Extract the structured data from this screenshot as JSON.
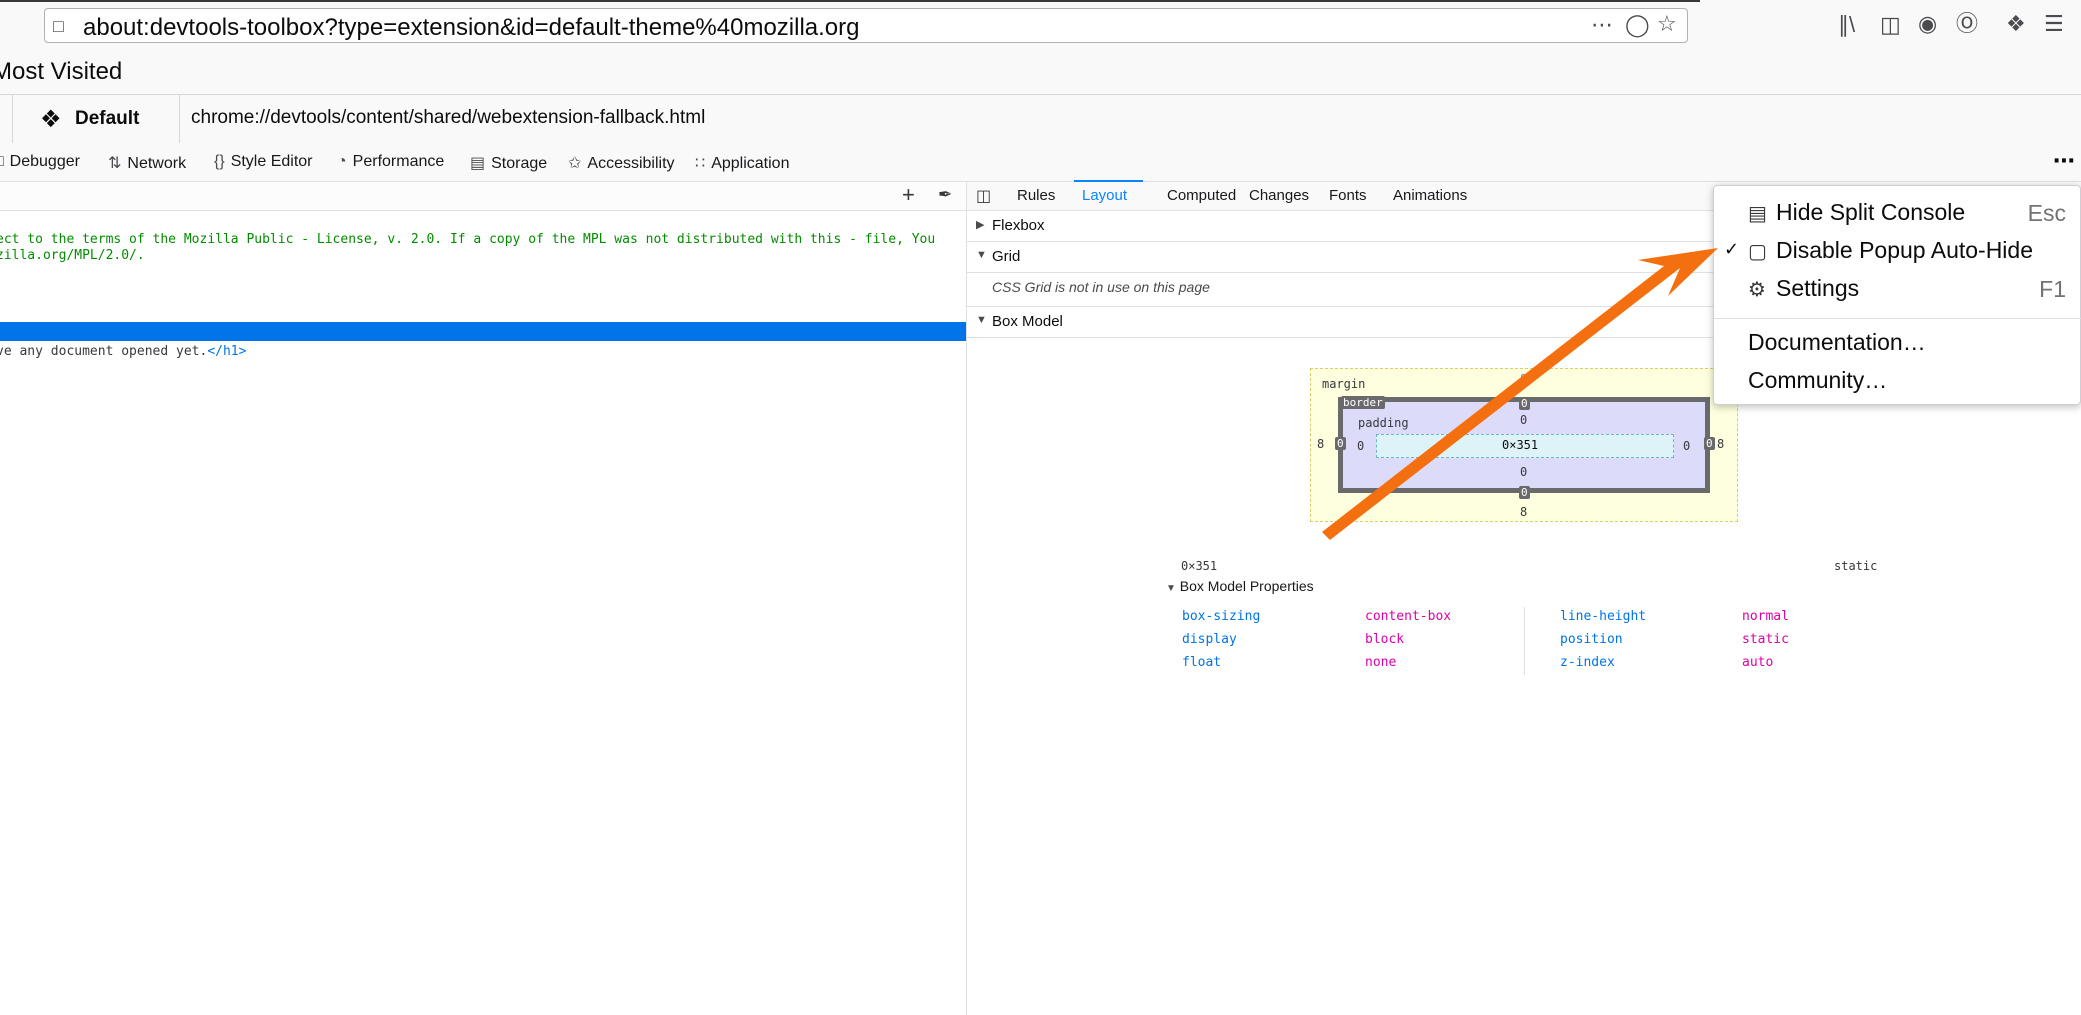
{
  "browser": {
    "url": "about:devtools-toolbox?type=extension&id=default-theme%40mozilla.org",
    "bookmarks_label": "Most Visited"
  },
  "extension": {
    "name": "Default",
    "url": "chrome://devtools/content/shared/webextension-fallback.html"
  },
  "tools": [
    "Debugger",
    "Network",
    "Style Editor",
    "Performance",
    "Storage",
    "Accessibility",
    "Application"
  ],
  "source": {
    "comment_line1": "ect to the terms of the Mozilla Public - License, v. 2.0. If a copy of the MPL was not distributed with this - file, You",
    "comment_line2": "zilla.org/MPL/2.0/.",
    "h1_text": "ve any document opened yet.",
    "h1_close": "</h1>"
  },
  "sidebar": {
    "tabs": [
      "Rules",
      "Layout",
      "Computed",
      "Changes",
      "Fonts",
      "Animations"
    ],
    "active_tab": "Layout",
    "flexbox": "Flexbox",
    "grid": "Grid",
    "grid_message": "CSS Grid is not in use on this page",
    "box_model": "Box Model"
  },
  "box_model": {
    "margin_label": "margin",
    "border_label": "border",
    "padding_label": "padding",
    "content_size": "0×351",
    "margin": {
      "top": "8",
      "right": "8",
      "bottom": "8",
      "left": "8"
    },
    "border": {
      "top": "0",
      "right": "0",
      "bottom": "0",
      "left": "0"
    },
    "padding": {
      "top": "0",
      "right": "0",
      "bottom": "0",
      "left": "0"
    },
    "summary_size": "0×351",
    "summary_position": "static",
    "properties_title": "Box Model Properties",
    "properties": [
      {
        "name": "box-sizing",
        "value": "content-box"
      },
      {
        "name": "display",
        "value": "block"
      },
      {
        "name": "float",
        "value": "none"
      },
      {
        "name": "line-height",
        "value": "normal"
      },
      {
        "name": "position",
        "value": "static"
      },
      {
        "name": "z-index",
        "value": "auto"
      }
    ]
  },
  "menu": {
    "items": [
      {
        "label": "Hide Split Console",
        "shortcut": "Esc"
      },
      {
        "label": "Disable Popup Auto-Hide",
        "shortcut": ""
      },
      {
        "label": "Settings",
        "shortcut": "F1"
      },
      {
        "label": "Documentation…",
        "shortcut": ""
      },
      {
        "label": "Community…",
        "shortcut": ""
      }
    ]
  },
  "colors": {
    "accent": "#0a84ff",
    "selection": "#0074e8",
    "arrow": "#f46f0f"
  }
}
